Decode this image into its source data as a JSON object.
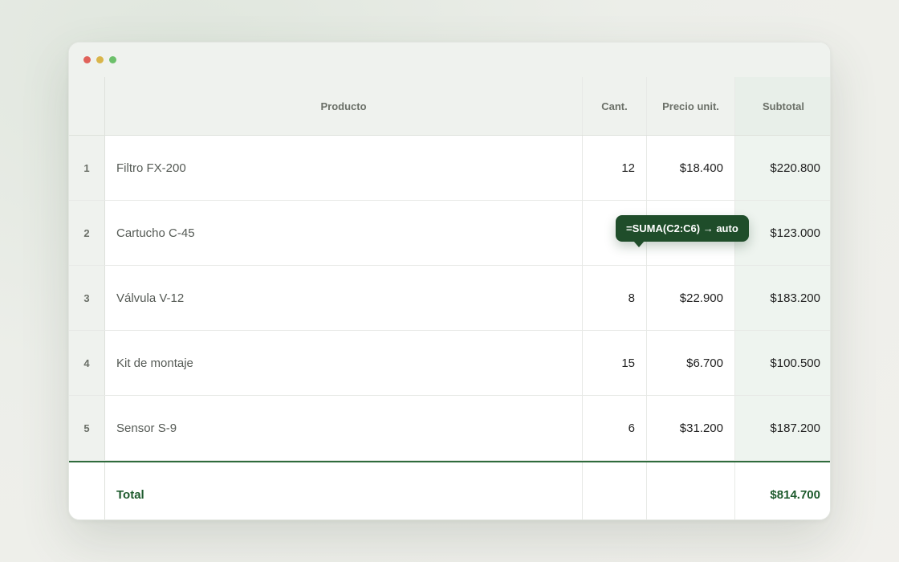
{
  "window": {
    "controls": [
      "close",
      "minimize",
      "maximize"
    ]
  },
  "table": {
    "headers": {
      "num": "",
      "product": "Producto",
      "qty": "Cant.",
      "price": "Precio unit.",
      "subtotal": "Subtotal"
    },
    "rows": [
      {
        "num": "1",
        "product": "Filtro FX-200",
        "qty": "12",
        "price": "$18.400",
        "subtotal": "$220.800"
      },
      {
        "num": "2",
        "product": "Cartucho C-45",
        "qty": "",
        "price": "",
        "subtotal": "$123.000"
      },
      {
        "num": "3",
        "product": "Válvula V-12",
        "qty": "8",
        "price": "$22.900",
        "subtotal": "$183.200"
      },
      {
        "num": "4",
        "product": "Kit de montaje",
        "qty": "15",
        "price": "$6.700",
        "subtotal": "$100.500"
      },
      {
        "num": "5",
        "product": "Sensor S-9",
        "qty": "6",
        "price": "$31.200",
        "subtotal": "$187.200"
      }
    ],
    "total": {
      "label": "Total",
      "value": "$814.700"
    }
  },
  "tooltip": {
    "text": "=SUMA(C2:C6) → auto"
  },
  "colors": {
    "accent": "#1f4d2a",
    "total_text": "#1d5a2c",
    "total_border": "#2f6b3c"
  }
}
